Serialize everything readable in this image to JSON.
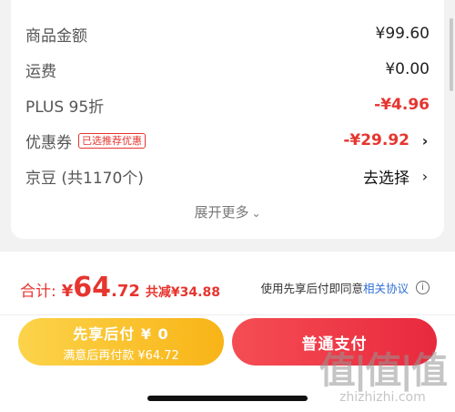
{
  "summary": {
    "rows": [
      {
        "label": "商品金额",
        "value": "¥99.60"
      },
      {
        "label": "运费",
        "value": "¥0.00"
      },
      {
        "label": "PLUS 95折",
        "value": "-¥4.96"
      },
      {
        "label": "优惠券",
        "badge": "已选推荐优惠",
        "value": "-¥29.92"
      },
      {
        "label": "京豆 (共1170个)",
        "value": "去选择"
      }
    ],
    "more_label": "展开更多",
    "more_chevron": "⌄",
    "row_chevron": "›"
  },
  "footer": {
    "total_label": "合计:",
    "total_yen": "¥",
    "total_int": "64",
    "total_dec": ".72",
    "saved_text": "共减¥34.88",
    "agree_prefix": "使用先享后付即同意",
    "agree_link": "相关协议",
    "info_glyph": "i",
    "pay_later_title": "先享后付 ¥ 0",
    "pay_later_sub": "满意后再付款 ¥64.72",
    "pay_now": "普通支付"
  },
  "watermark": {
    "logo": "值|值|值",
    "url": "zhizhizhi.com"
  },
  "colors": {
    "accent_red": "#e6352f",
    "link_blue": "#2f6fd6",
    "pay_later_yellow": "#f8b417",
    "pay_now_red": "#e8293d"
  },
  "icons": {
    "chevron": "chevron-right-icon",
    "expand": "chevron-down-icon",
    "info": "info-icon"
  }
}
